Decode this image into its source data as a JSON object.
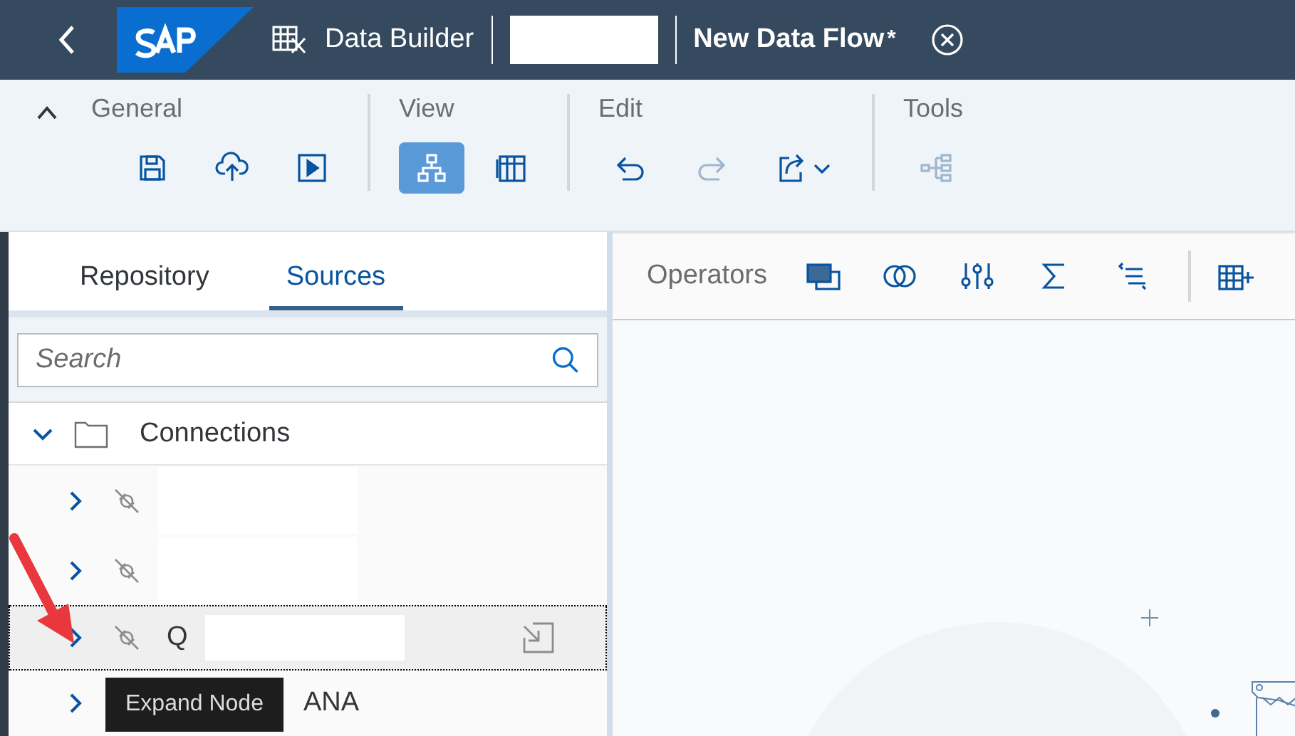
{
  "header": {
    "app": "Data Builder",
    "title": "New Data Flow",
    "modified_mark": "*"
  },
  "toolbar": {
    "expanded": true,
    "groups": [
      {
        "label": "General",
        "buttons": [
          {
            "selected": false,
            "disabled": false
          },
          {
            "selected": false,
            "disabled": false
          },
          {
            "selected": false,
            "disabled": false
          }
        ]
      },
      {
        "label": "View",
        "buttons": [
          {
            "selected": true,
            "disabled": false
          },
          {
            "selected": false,
            "disabled": false
          }
        ]
      },
      {
        "label": "Edit",
        "buttons": [
          {
            "selected": false,
            "disabled": false
          },
          {
            "selected": false,
            "disabled": true
          },
          {
            "selected": false,
            "disabled": false
          }
        ]
      },
      {
        "label": "Tools",
        "buttons": [
          {
            "selected": false,
            "disabled": true
          }
        ]
      }
    ]
  },
  "tabs": [
    {
      "label": "Repository",
      "selected": false
    },
    {
      "label": "Sources",
      "selected": true
    }
  ],
  "search": {
    "placeholder": "Search"
  },
  "tree": [
    {
      "label": "Connections",
      "expanded": true,
      "children": [
        {
          "redacted": true,
          "selected": false,
          "expanded": false
        },
        {
          "redacted": true,
          "selected": false,
          "expanded": false
        },
        {
          "label": "Q",
          "redacted": true,
          "selected": true,
          "expanded": false
        },
        {
          "label": "ANA",
          "redacted": false,
          "selected": false,
          "expanded": false
        }
      ]
    }
  ],
  "tooltip": "Expand Node",
  "operators": {
    "label": "Operators"
  }
}
